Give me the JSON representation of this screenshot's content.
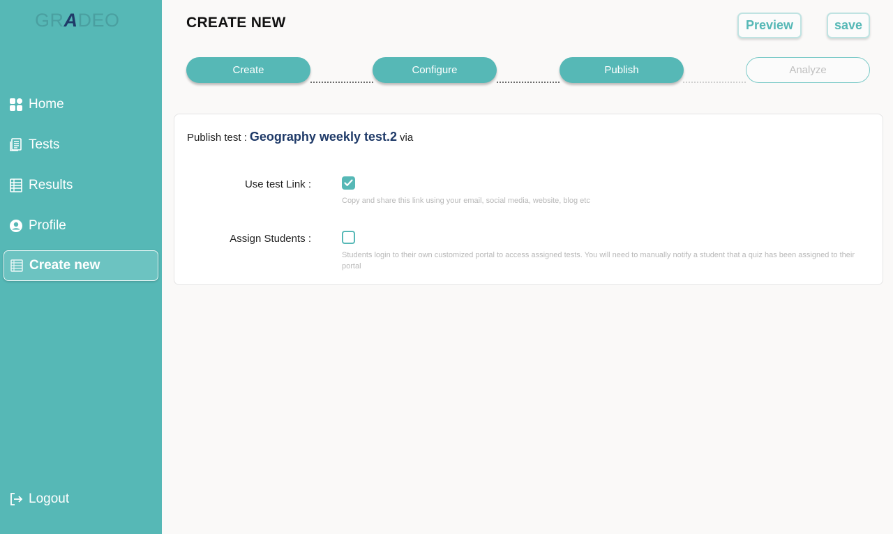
{
  "app": {
    "logo_pre": "GR",
    "logo_mid": "A",
    "logo_post": "DEO"
  },
  "sidebar": {
    "items": [
      {
        "label": "Home",
        "icon": "dashboard-icon"
      },
      {
        "label": "Tests",
        "icon": "document-icon"
      },
      {
        "label": "Results",
        "icon": "list-icon"
      },
      {
        "label": "Profile",
        "icon": "user-icon"
      },
      {
        "label": "Create new",
        "icon": "create-icon",
        "active": true
      }
    ],
    "logout_label": "Logout"
  },
  "header": {
    "title": "CREATE NEW",
    "preview_label": "Preview",
    "save_label": "save"
  },
  "stepper": {
    "steps": [
      {
        "label": "Create",
        "state": "done"
      },
      {
        "label": "Configure",
        "state": "done"
      },
      {
        "label": "Publish",
        "state": "done"
      },
      {
        "label": "Analyze",
        "state": "todo"
      }
    ]
  },
  "publish": {
    "prefix": "Publish test :",
    "test_name": "Geography weekly test.2",
    "suffix": "via",
    "options": [
      {
        "label": "Use test Link :",
        "checked": true,
        "help": "Copy and share this link using your email, social media, website, blog etc"
      },
      {
        "label": "Assign Students :",
        "checked": false,
        "help": "Students login to their own customized portal to access assigned tests. You will need to manually notify a student that a quiz has been assigned to their portal"
      }
    ]
  },
  "colors": {
    "accent": "#56b8b6",
    "title_blue": "#1f3a68"
  }
}
